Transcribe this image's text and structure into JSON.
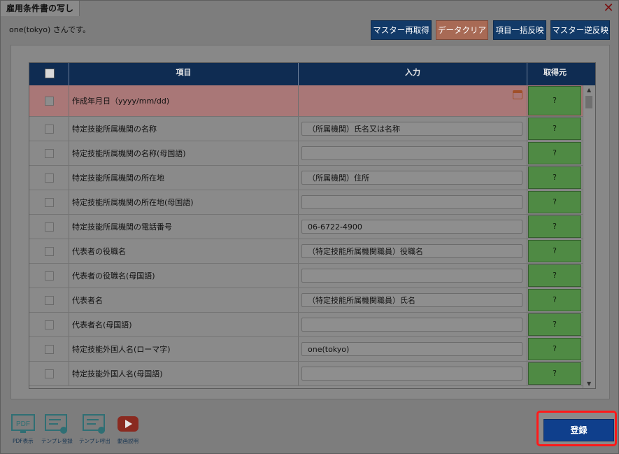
{
  "dialog": {
    "title": "雇用条件書の写し",
    "close_symbol": "✕",
    "user_text": "one(tokyo) さんです。"
  },
  "toolbar": {
    "master_refetch": "マスター再取得",
    "data_clear": "データクリア",
    "bulk_apply": "項目一括反映",
    "master_reverse": "マスター逆反映"
  },
  "table": {
    "headers": {
      "item": "項目",
      "input": "入力",
      "source": "取得元"
    },
    "rows": [
      {
        "label": "作成年月日（yyyy/mm/dd)",
        "value": "",
        "source": "?",
        "highlight": true,
        "calendar": true
      },
      {
        "label": "特定技能所属機関の名称",
        "value": "（所属機関）氏名又は名称",
        "source": "?"
      },
      {
        "label": "特定技能所属機関の名称(母国語)",
        "value": "",
        "source": "?"
      },
      {
        "label": "特定技能所属機関の所在地",
        "value": "（所属機関）住所",
        "source": "?"
      },
      {
        "label": "特定技能所属機関の所在地(母国語)",
        "value": "",
        "source": "?"
      },
      {
        "label": "特定技能所属機関の電話番号",
        "value": "06-6722-4900",
        "source": "?"
      },
      {
        "label": "代表者の役職名",
        "value": "（特定技能所属機関職員）役職名",
        "source": "?"
      },
      {
        "label": "代表者の役職名(母国語)",
        "value": "",
        "source": "?"
      },
      {
        "label": "代表者名",
        "value": "（特定技能所属機関職員）氏名",
        "source": "?"
      },
      {
        "label": "代表者名(母国語)",
        "value": "",
        "source": "?"
      },
      {
        "label": "特定技能外国人名(ローマ字)",
        "value": "one(tokyo)",
        "source": "?"
      },
      {
        "label": "特定技能外国人名(母国語)",
        "value": "",
        "source": "?"
      }
    ]
  },
  "footer": {
    "icons": [
      {
        "name": "pdf-icon",
        "label": "PDF表示",
        "glyph": "PDF"
      },
      {
        "name": "template-register-icon",
        "label": "テンプレ登録"
      },
      {
        "name": "template-load-icon",
        "label": "テンプレ呼出"
      },
      {
        "name": "video-icon",
        "label": "動画説明"
      }
    ],
    "register_label": "登録"
  },
  "colors": {
    "header_navy": "#0f2c52",
    "source_green": "#4f8a44",
    "highlight_outline": "#ff1a1a",
    "register_blue": "#0f3f8c"
  }
}
